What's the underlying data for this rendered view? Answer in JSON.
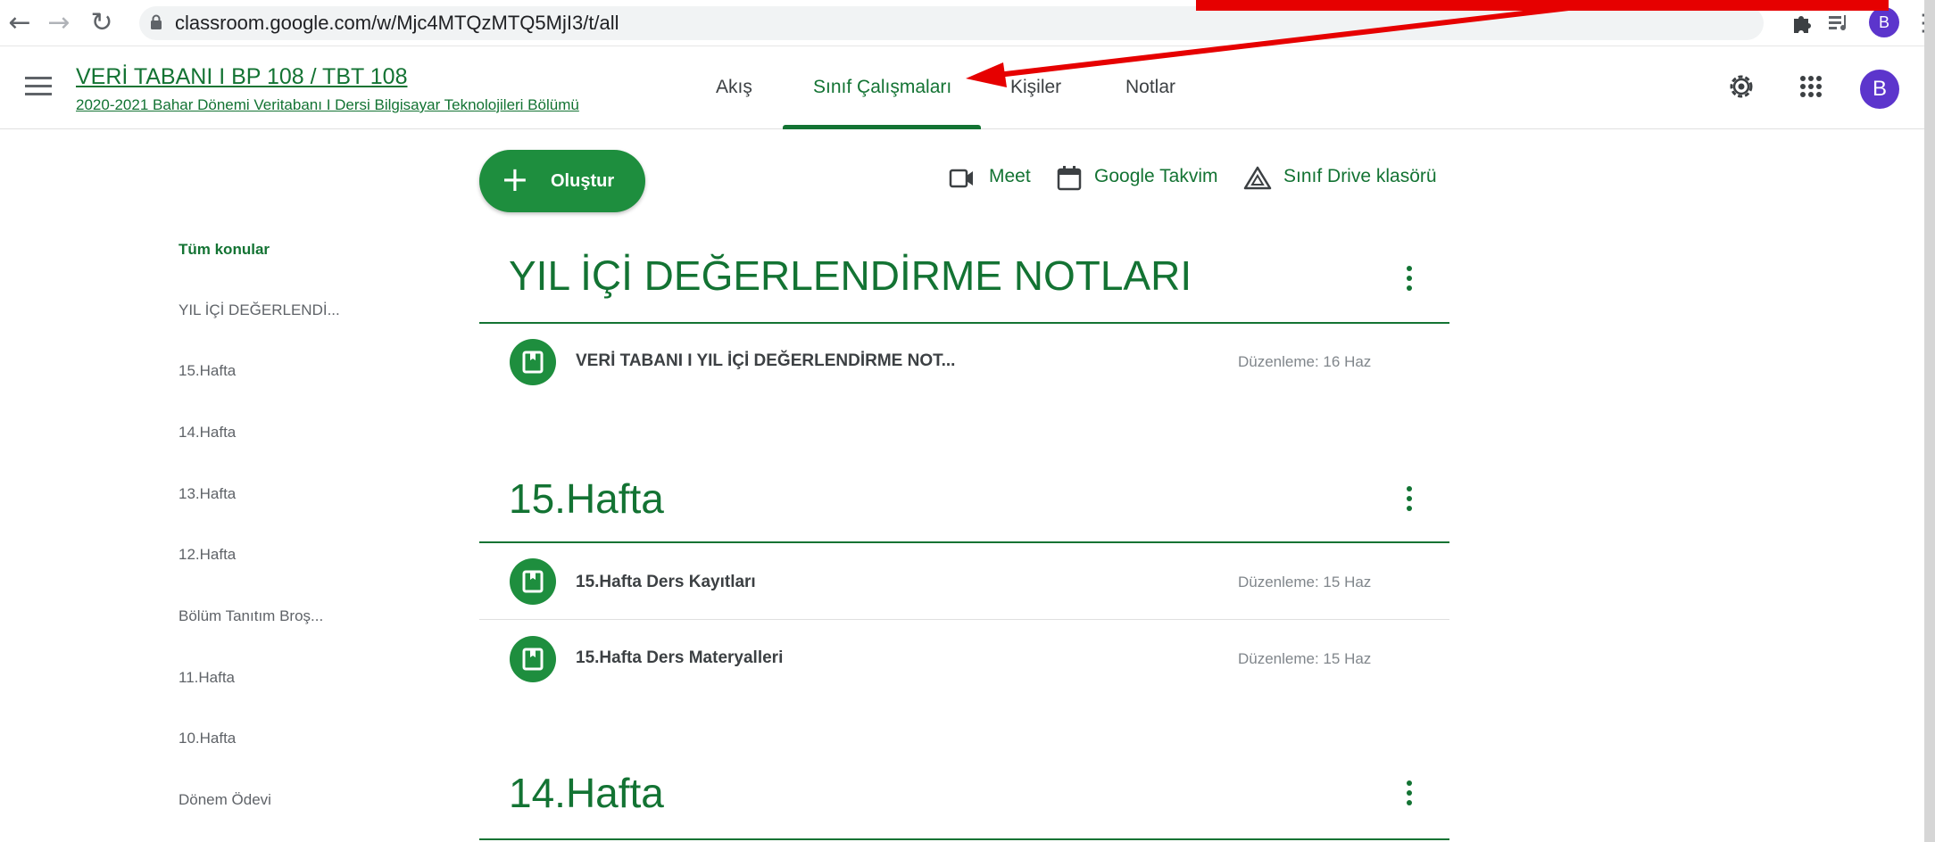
{
  "browser": {
    "url": "classroom.google.com/w/Mjc4MTQzMTQ5MjI3/t/all",
    "avatar_letter": "B"
  },
  "header": {
    "class_title": "VERİ TABANI I BP 108 / TBT 108",
    "class_subtitle": "2020-2021 Bahar Dönemi Veritabanı I Dersi Bilgisayar Teknolojileri Bölümü",
    "tabs": [
      {
        "label": "Akış",
        "active": false
      },
      {
        "label": "Sınıf Çalışmaları",
        "active": true
      },
      {
        "label": "Kişiler",
        "active": false
      },
      {
        "label": "Notlar",
        "active": false
      }
    ],
    "user_avatar_letter": "B"
  },
  "toolbar": {
    "create_label": "Oluştur",
    "meet_label": "Meet",
    "calendar_label": "Google Takvim",
    "drive_label": "Sınıf Drive klasörü"
  },
  "sidebar": {
    "items": [
      {
        "label": "Tüm konular",
        "active": true
      },
      {
        "label": "YIL İÇİ DEĞERLENDİ...",
        "active": false
      },
      {
        "label": "15.Hafta",
        "active": false
      },
      {
        "label": "14.Hafta",
        "active": false
      },
      {
        "label": "13.Hafta",
        "active": false
      },
      {
        "label": "12.Hafta",
        "active": false
      },
      {
        "label": "Bölüm Tanıtım Broş...",
        "active": false
      },
      {
        "label": "11.Hafta",
        "active": false
      },
      {
        "label": "10.Hafta",
        "active": false
      },
      {
        "label": "Dönem Ödevi",
        "active": false
      }
    ]
  },
  "topics": [
    {
      "title": "YIL İÇİ DEĞERLENDİRME NOTLARI",
      "items": [
        {
          "title": "VERİ TABANI I YIL İÇİ DEĞERLENDİRME NOT...",
          "date": "Düzenleme: 16 Haz"
        }
      ]
    },
    {
      "title": "15.Hafta",
      "items": [
        {
          "title": "15.Hafta Ders Kayıtları",
          "date": "Düzenleme: 15 Haz"
        },
        {
          "title": "15.Hafta Ders Materyalleri",
          "date": "Düzenleme: 15 Haz"
        }
      ]
    },
    {
      "title": "14.Hafta",
      "items": []
    }
  ],
  "colors": {
    "accent": "#137333",
    "button": "#1e8e3e",
    "avatar": "#5c35cc",
    "annotation_arrow": "#e60000"
  }
}
